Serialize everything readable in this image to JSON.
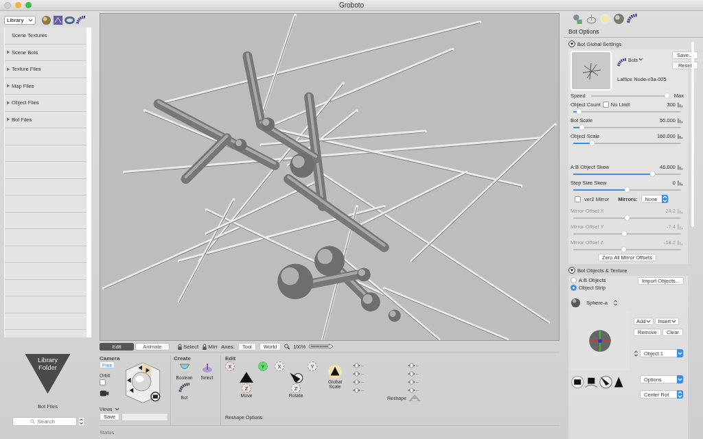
{
  "window": {
    "title": "Groboto"
  },
  "library": {
    "dropdown": "Library",
    "items": [
      {
        "label": "Scene Textures",
        "expandable": false
      },
      {
        "label": "Scene Bots",
        "expandable": true
      },
      {
        "label": "Texture Files",
        "expandable": true
      },
      {
        "label": "Map Files",
        "expandable": true
      },
      {
        "label": "Object Files",
        "expandable": true
      },
      {
        "label": "Bot Files",
        "expandable": true
      }
    ],
    "folder_label": "Library Folder",
    "folder_caption": "Bot Files",
    "search_placeholder": "Search"
  },
  "viewport_bar": {
    "mode_tabs": [
      {
        "label": "Edit",
        "selected": true
      },
      {
        "label": "Animate",
        "selected": false
      }
    ],
    "locks": [
      "Select",
      "Mirr"
    ],
    "axes_label": "Axes:",
    "axes_buttons": [
      "Tool",
      "World"
    ],
    "zoom": "100%"
  },
  "camera": {
    "title": "Camera",
    "mode": "Free",
    "orbit_label": "Orbit",
    "orbit": false,
    "views_label": "Views",
    "save": "Save"
  },
  "create": {
    "title": "Create",
    "tools": [
      "Boolean",
      "Select",
      "Bot"
    ]
  },
  "edit": {
    "title": "Edit",
    "move_axes": [
      {
        "label": "X",
        "selected": false
      },
      {
        "label": "Y",
        "selected": true
      },
      {
        "label": "Z",
        "selected": false
      }
    ],
    "move_label": "Move",
    "rotate_axes": [
      "X",
      "Y",
      "Z"
    ],
    "rotate_label": "Rotate",
    "global_scale": "Global Scale",
    "reshape_values": [
      "--",
      "--",
      "--",
      "--",
      "--",
      "--",
      "--",
      "--"
    ],
    "reshape_label": "Reshape",
    "reshape_options": "Reshape Options:"
  },
  "status": "Status",
  "bot_options": {
    "title": "Bot Options",
    "global": {
      "title": "Bot Global Settings",
      "expanded": true,
      "save": "Save...",
      "reset": "Reset",
      "bots": "Bots",
      "bot_name": "Lattice Node-v3a-005",
      "speed": {
        "label": "Speed",
        "max": "Max",
        "level": 0.98
      },
      "sliders": [
        {
          "label": "Object Count",
          "value": "300",
          "level": 0.06,
          "disabled": false,
          "checkbox": {
            "label": "No Limit",
            "checked": false
          }
        },
        {
          "label": "Bot Scale",
          "value": "50.000",
          "level": 0.08,
          "disabled": false
        },
        {
          "label": "Object Scale",
          "value": "160.000",
          "level": 0.18,
          "disabled": false
        }
      ],
      "skew_sliders": [
        {
          "label": "A:B Object Skew",
          "value": "46.000",
          "level": 0.74,
          "disabled": false
        },
        {
          "label": "Step Size Skew",
          "value": "0",
          "level": 0.5,
          "disabled": false
        }
      ],
      "ver2_mirror": {
        "label": "ver2 Mirror",
        "checked": false
      },
      "mirrors_label": "Mirrors:",
      "mirrors_value": "None",
      "mirror_sliders": [
        {
          "label": "Mirror Offset X",
          "value": "24.2",
          "level": 0.5,
          "disabled": true
        },
        {
          "label": "Mirror Offset Y",
          "value": "-7.4",
          "level": 0.48,
          "disabled": true
        },
        {
          "label": "Mirror Offset Z",
          "value": "-18.2",
          "level": 0.47,
          "disabled": true
        }
      ],
      "zero_button": "Zero All Mirror Offsets"
    },
    "objects": {
      "title": "Bot Objects & Texture",
      "expanded": true,
      "modes": [
        {
          "label": "A:B Objects",
          "selected": false
        },
        {
          "label": "Object Strip",
          "selected": true
        }
      ],
      "import": "Import Objects...",
      "object_name": "Sphere-a",
      "add": "Add",
      "insert": "Insert",
      "remove": "Remove",
      "clear": "Clear",
      "object_index": "Object:1",
      "options": "Options",
      "center": "Center Rot"
    }
  }
}
